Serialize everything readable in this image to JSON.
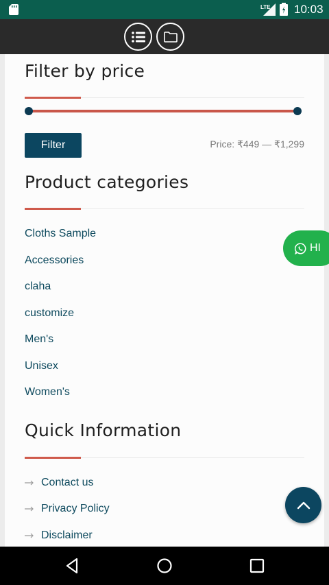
{
  "status_bar": {
    "time": "10:03",
    "network": "LTE",
    "icons": [
      "sd-card-icon",
      "signal-icon",
      "battery-icon"
    ]
  },
  "top_nav": {
    "icons": [
      "menu-list-icon",
      "folder-icon"
    ]
  },
  "filter_by_price": {
    "title": "Filter by price",
    "button_label": "Filter",
    "price_text": "Price: ₹449 — ₹1,299",
    "range_min_fraction": 0.0,
    "range_max_fraction": 1.0
  },
  "product_categories": {
    "title": "Product categories",
    "items": [
      "Cloths Sample",
      "Accessories",
      "claha",
      "customize",
      "Men's",
      "Unisex",
      "Women's"
    ]
  },
  "quick_information": {
    "title": "Quick Information",
    "items": [
      "Contact us",
      "Privacy Policy",
      "Disclaimer"
    ]
  },
  "whatsapp": {
    "label": "HI"
  },
  "colors": {
    "accent_red": "#cf5a4c",
    "primary_blue": "#0c4660",
    "link_blue": "#0e4a5e",
    "whatsapp_green": "#22b14c",
    "status_bar": "#0b5e4e"
  }
}
